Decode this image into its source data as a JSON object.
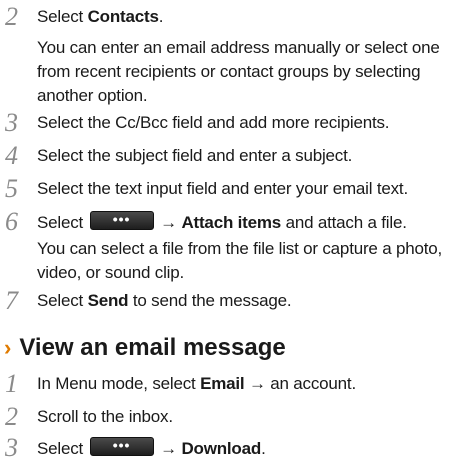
{
  "steps_top": [
    {
      "num": "2",
      "pre": "Select ",
      "bold": "Contacts",
      "post": ".",
      "sub": "You can enter an email address manually or select one from recent recipients or contact groups by selecting another option."
    },
    {
      "num": "3",
      "text": "Select the Cc/Bcc field and add more recipients."
    },
    {
      "num": "4",
      "text": "Select the subject field and enter a subject."
    },
    {
      "num": "5",
      "text": "Select the text input field and enter your email text."
    },
    {
      "num": "6",
      "pre": "Select ",
      "button": "•••",
      "arrow": " → ",
      "bold": "Attach items",
      "post": " and attach a file.",
      "sub": "You can select a file from the file list or capture a photo, video, or sound clip."
    },
    {
      "num": "7",
      "pre": "Select ",
      "bold": "Send",
      "post": " to send the message."
    }
  ],
  "section": {
    "chevron": "›",
    "title": "View an email message"
  },
  "steps_bottom": [
    {
      "num": "1",
      "pre": "In Menu mode, select ",
      "bold": "Email",
      "post": " → an account."
    },
    {
      "num": "2",
      "text": "Scroll to the inbox."
    },
    {
      "num": "3",
      "pre": "Select ",
      "button": "•••",
      "arrow": " → ",
      "bold": "Download",
      "post": "."
    }
  ]
}
